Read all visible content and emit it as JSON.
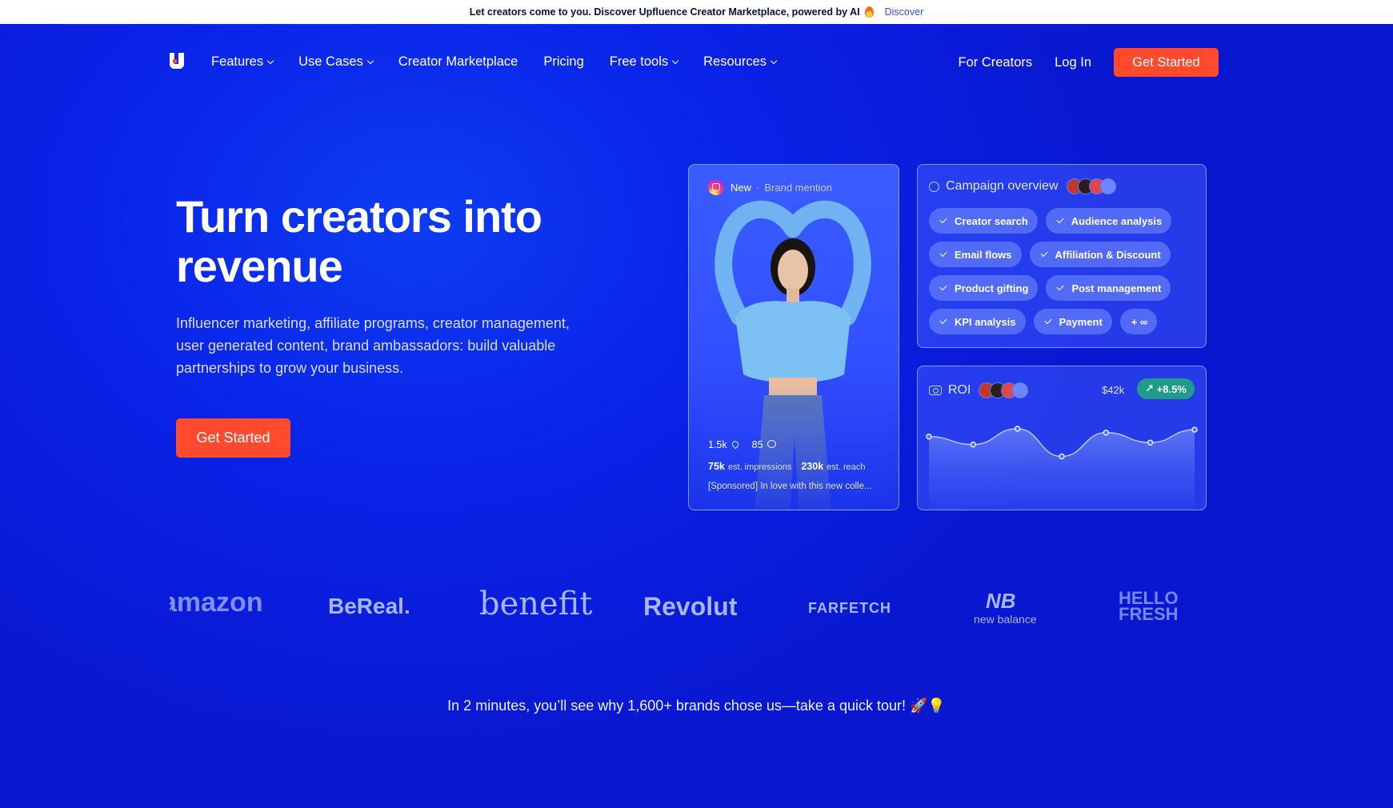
{
  "announcement": {
    "text": "Let creators come to you. Discover Upfluence Creator Marketplace, powered by AI",
    "link": "Discover"
  },
  "nav": {
    "items": [
      {
        "label": "Features",
        "dropdown": true
      },
      {
        "label": "Use Cases",
        "dropdown": true
      },
      {
        "label": "Creator Marketplace",
        "dropdown": false
      },
      {
        "label": "Pricing",
        "dropdown": false
      },
      {
        "label": "Free tools",
        "dropdown": true
      },
      {
        "label": "Resources",
        "dropdown": true
      }
    ],
    "for_creators": "For Creators",
    "login": "Log In",
    "cta": "Get Started"
  },
  "hero": {
    "headline_line1": "Turn creators into",
    "headline_line2": "revenue",
    "subtitle": "Influencer marketing, affiliate programs, creator management, user generated content, brand ambassadors: build valuable partnerships to grow your business.",
    "cta": "Get Started"
  },
  "post_card": {
    "tag": "New",
    "type": "Brand mention",
    "likes": "1.5k",
    "comments": "85",
    "impressions": "75k",
    "impressions_label": "est. impressions",
    "reach": "230k",
    "reach_label": "est. reach",
    "caption": "[Sponsored] In love with this new colle..."
  },
  "campaign": {
    "title": "Campaign overview",
    "chips": [
      "Creator search",
      "Audience analysis",
      "Email flows",
      "Affiliation & Discount",
      "Product gifting",
      "Post management",
      "KPI analysis",
      "Payment"
    ],
    "more": "+ ∞"
  },
  "roi": {
    "title": "ROI",
    "value": "$42k",
    "change": "+8.5%",
    "points": [
      0.52,
      0.36,
      0.68,
      0.12,
      0.6,
      0.4,
      0.66
    ]
  },
  "logos": [
    "amazon",
    "BeReal.",
    "benefit",
    "Revolut",
    "FARFETCH",
    "new balance",
    "HELLO FRESH"
  ],
  "tour_text": "In 2 minutes, you’ll see why 1,600+ brands chose us—take a quick tour! 🚀💡",
  "colors": {
    "accent": "#ff4a2e",
    "background": "#0a1fe6",
    "badge": "#1f9c8a"
  }
}
